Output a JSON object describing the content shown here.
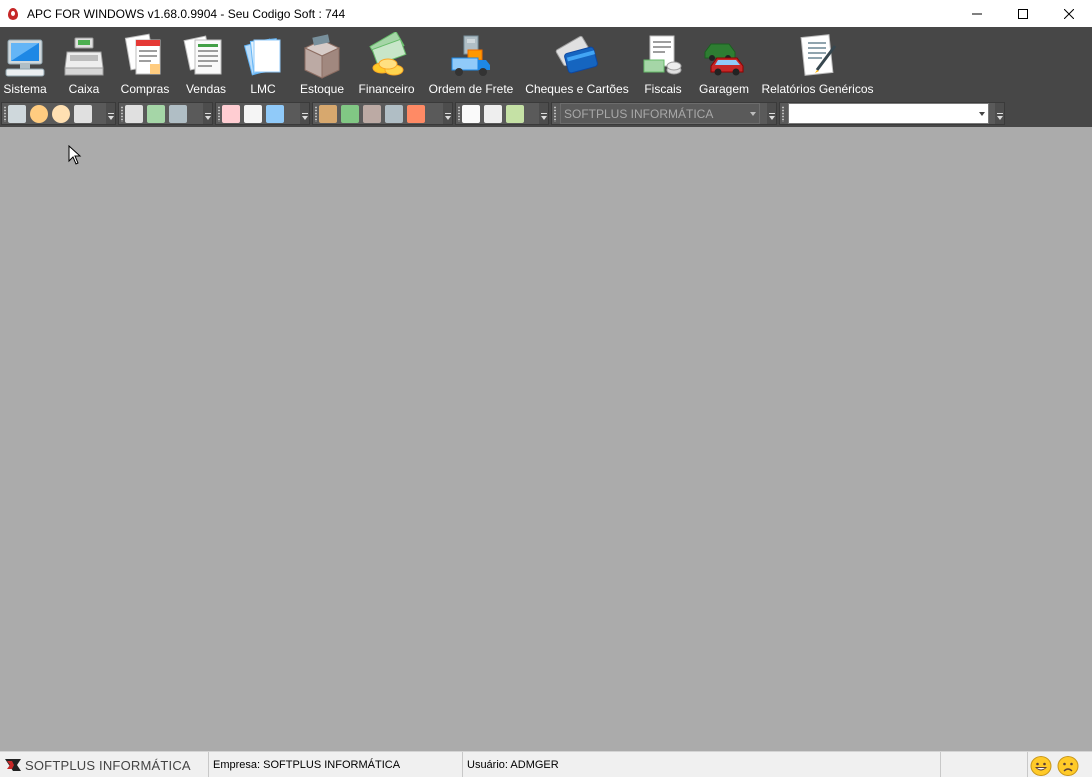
{
  "window": {
    "title": "APC FOR WINDOWS v1.68.0.9904 - Seu Codigo Soft : 744",
    "controls": [
      "minimize-icon",
      "maximize-icon",
      "close-icon"
    ]
  },
  "menu": {
    "items": [
      {
        "label": "Sistema",
        "icon": "computer-icon"
      },
      {
        "label": "Caixa",
        "icon": "cash-register-icon"
      },
      {
        "label": "Compras",
        "icon": "invoices-icon"
      },
      {
        "label": "Vendas",
        "icon": "sales-documents-icon"
      },
      {
        "label": "LMC",
        "icon": "document-stack-icon"
      },
      {
        "label": "Estoque",
        "icon": "inventory-box-icon"
      },
      {
        "label": "Financeiro",
        "icon": "money-coins-icon"
      },
      {
        "label": "Ordem de Frete",
        "icon": "delivery-truck-icon"
      },
      {
        "label": "Cheques e Cartões",
        "icon": "credit-cards-icon"
      },
      {
        "label": "Fiscais",
        "icon": "tax-document-icon"
      },
      {
        "label": "Garagem",
        "icon": "cars-icon"
      },
      {
        "label": "Relatórios Genéricos",
        "icon": "report-clipboard-icon"
      }
    ]
  },
  "toolbar": {
    "company_combo": {
      "value": "SOFTPLUS INFORMÁTICA"
    },
    "search_combo": {
      "value": ""
    }
  },
  "status": {
    "brand": "SOFTPLUS INFORMÁTICA",
    "empresa": "Empresa: SOFTPLUS INFORMÁTICA",
    "usuario": "Usuário: ADMGER"
  },
  "colors": {
    "toolbar_bg": "#474747",
    "workspace_bg": "#ababab",
    "statusbar_bg": "#f0f0f0",
    "accent_red": "#c62828"
  }
}
